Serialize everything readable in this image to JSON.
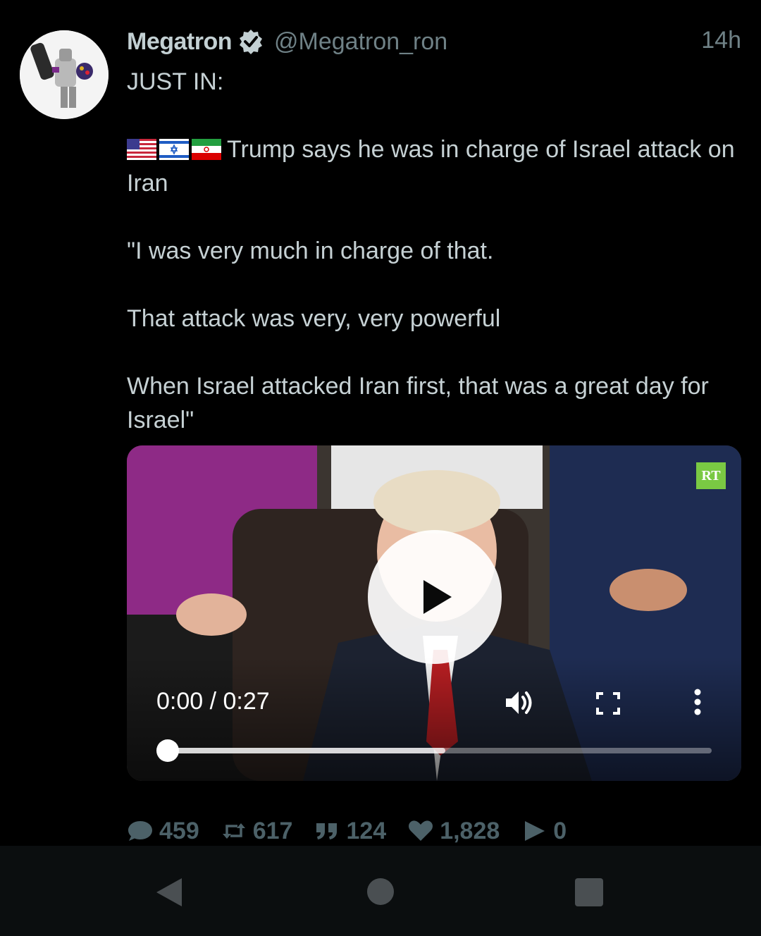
{
  "tweet": {
    "display_name": "Megatron",
    "handle": "@Megatron_ron",
    "time": "14h",
    "lines": {
      "l1": "JUST IN:",
      "l2": "Trump says he was in charge of Israel attack on Iran",
      "l3": "\"I was very much in charge of that.",
      "l4": "That attack was very, very powerful",
      "l5": "When Israel attacked Iran first, that was a great day for Israel\""
    },
    "flags": [
      "us-flag",
      "israel-flag",
      "iran-flag"
    ]
  },
  "video": {
    "logo": "RT",
    "time_display": "0:00 / 0:27",
    "played_fraction": 0,
    "buffered_fraction": 0.51
  },
  "stats": {
    "replies": "459",
    "retweets": "617",
    "quotes": "124",
    "likes": "1,828",
    "views": "0"
  },
  "colors": {
    "background": "#000000",
    "text": "#c6d1d4",
    "muted": "#6f8186",
    "stat": "#4c6168",
    "rt_green": "#7ac943"
  }
}
